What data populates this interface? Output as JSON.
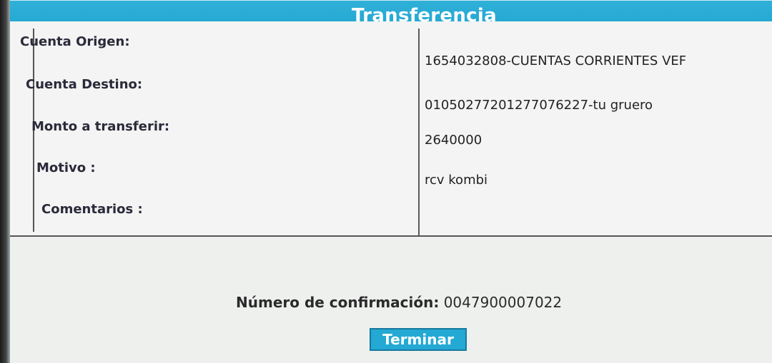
{
  "header": {
    "title": "Transferencia"
  },
  "fields": [
    {
      "label": "Cuenta Origen:",
      "value": "1654032808-CUENTAS CORRIENTES VEF"
    },
    {
      "label": "Cuenta Destino:",
      "value": "01050277201277076227-tu gruero"
    },
    {
      "label": "Monto a transferir:",
      "value": "2640000"
    },
    {
      "label": "Motivo :",
      "value": "rcv kombi"
    },
    {
      "label": "Comentarios :",
      "value": ""
    }
  ],
  "confirmation": {
    "label": "Número de confirmación:",
    "number": "0047900007022"
  },
  "actions": {
    "finish_label": "Terminar"
  }
}
